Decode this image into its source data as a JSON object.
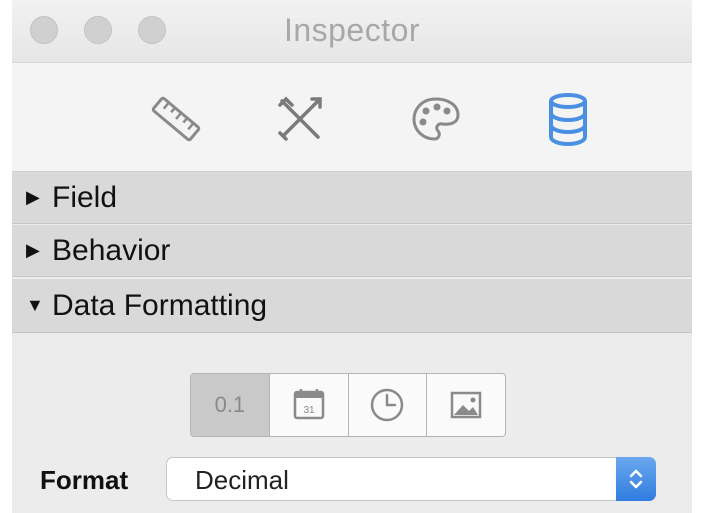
{
  "window": {
    "title": "Inspector"
  },
  "toolbar": {
    "tools": [
      {
        "icon": "ruler-icon",
        "selected": false
      },
      {
        "icon": "tools-icon",
        "selected": false
      },
      {
        "icon": "palette-icon",
        "selected": false
      },
      {
        "icon": "database-icon",
        "selected": true
      }
    ],
    "accent_color": "#4a90e2"
  },
  "sections": [
    {
      "label": "Field",
      "expanded": false,
      "indicator": "▶"
    },
    {
      "label": "Behavior",
      "expanded": false,
      "indicator": "▶"
    },
    {
      "label": "Data Formatting",
      "expanded": true,
      "indicator": "▼"
    }
  ],
  "formatting": {
    "types": [
      {
        "label": "0.1",
        "icon": "number-icon",
        "selected": true
      },
      {
        "label": "31",
        "icon": "calendar-icon",
        "selected": false
      },
      {
        "label": "",
        "icon": "clock-icon",
        "selected": false
      },
      {
        "label": "",
        "icon": "image-icon",
        "selected": false
      }
    ],
    "format_label": "Format",
    "format_value": "Decimal"
  }
}
